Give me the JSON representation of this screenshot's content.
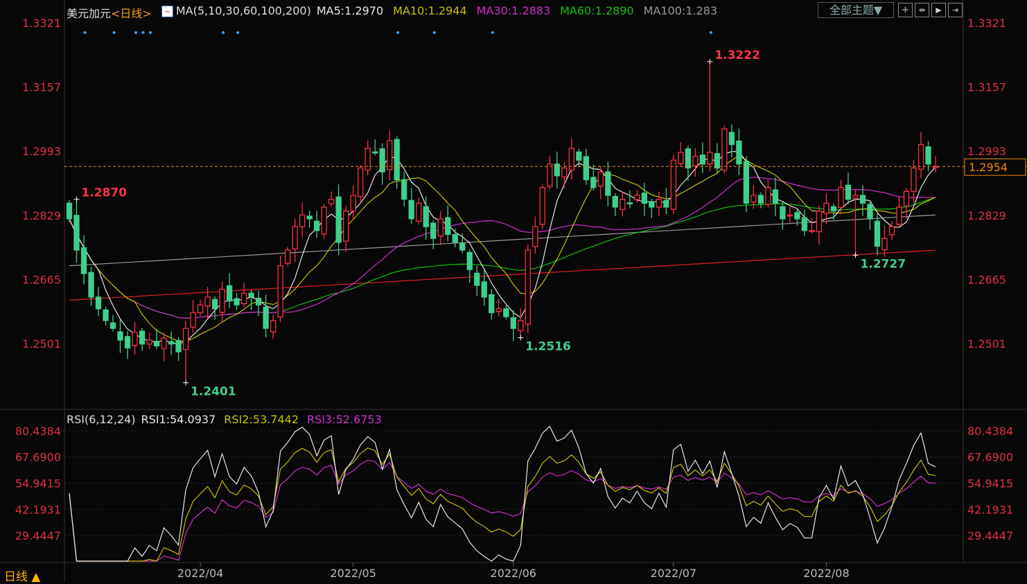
{
  "header": {
    "symbol": "美元加元",
    "period_tag": "<日线>",
    "ma_label": "MA(5,10,30,60,100,200)",
    "ma5": "MA5:1.2970",
    "ma10": "MA10:1.2944",
    "ma30": "MA30:1.2883",
    "ma60": "MA60:1.2890",
    "ma100": "MA100:1.283",
    "theme_button": "全部主题▼"
  },
  "rsi_header": {
    "label": "RSI(6,12,24)",
    "rsi1": "RSI1:54.0937",
    "rsi2": "RSI2:53.7442",
    "rsi3": "RSI3:52.6753"
  },
  "footer": {
    "period_button": "日线 ▲"
  },
  "colors": {
    "up": "#ff2d43",
    "down": "#3fcf8c",
    "ma5": "#e8e8e8",
    "ma10": "#c8c000",
    "ma30": "#d030d0",
    "ma60": "#10c010",
    "ma100": "#9a9a9a",
    "ma200": "#e02020",
    "last_price": "#f08c00"
  },
  "chart_data": [
    {
      "type": "candlestick",
      "title": "美元加元 日线",
      "y_ticks": [
        "1.3321",
        "1.3157",
        "1.2993",
        "1.2829",
        "1.2665",
        "1.2501"
      ],
      "ylim": [
        1.2401,
        1.3321
      ],
      "x_ticks": [
        {
          "label": "2022/04",
          "index": 18
        },
        {
          "label": "2022/05",
          "index": 39
        },
        {
          "label": "2022/06",
          "index": 61
        },
        {
          "label": "2022/07",
          "index": 83
        },
        {
          "label": "2022/08",
          "index": 104
        }
      ],
      "close": [
        1.282,
        1.274,
        1.268,
        1.262,
        1.259,
        1.256,
        1.254,
        1.251,
        1.249,
        1.253,
        1.25,
        1.251,
        1.2495,
        1.2515,
        1.25,
        1.248,
        1.254,
        1.258,
        1.26,
        1.262,
        1.259,
        1.264,
        1.261,
        1.26,
        1.263,
        1.262,
        1.26,
        1.254,
        1.256,
        1.27,
        1.274,
        1.28,
        1.283,
        1.282,
        1.279,
        1.285,
        1.287,
        1.276,
        1.284,
        1.288,
        1.295,
        1.3,
        1.299,
        1.294,
        1.302,
        1.292,
        1.287,
        1.282,
        1.286,
        1.28,
        1.277,
        1.282,
        1.278,
        1.276,
        1.274,
        1.269,
        1.265,
        1.262,
        1.258,
        1.259,
        1.257,
        1.254,
        1.256,
        1.274,
        1.28,
        1.29,
        1.296,
        1.293,
        1.295,
        1.3,
        1.297,
        1.292,
        1.29,
        1.294,
        1.288,
        1.285,
        1.287,
        1.286,
        1.288,
        1.286,
        1.285,
        1.287,
        1.285,
        1.297,
        1.299,
        1.295,
        1.298,
        1.296,
        1.299,
        1.295,
        1.305,
        1.301,
        1.296,
        1.286,
        1.288,
        1.286,
        1.29,
        1.286,
        1.282,
        1.283,
        1.282,
        1.279,
        1.279,
        1.284,
        1.286,
        1.284,
        1.29,
        1.287,
        1.288,
        1.286,
        1.282,
        1.275,
        1.277,
        1.28,
        1.285,
        1.289,
        1.295,
        1.301,
        1.296,
        1.2954
      ],
      "ma200_range": [
        1.2612,
        1.274
      ],
      "ma100_range": [
        1.27,
        1.283
      ],
      "annotations": [
        {
          "label": "1.2870",
          "index": 1,
          "kind": "high"
        },
        {
          "label": "1.2401",
          "index": 16,
          "kind": "low"
        },
        {
          "label": "1.2516",
          "index": 62,
          "kind": "low"
        },
        {
          "label": "1.3222",
          "index": 88,
          "kind": "high"
        },
        {
          "label": "1.2727",
          "index": 108,
          "kind": "low"
        }
      ],
      "last_price": "1.2954",
      "signal_dots": [
        1,
        5,
        8,
        9,
        10,
        20,
        22,
        44,
        49,
        57,
        87
      ]
    },
    {
      "type": "line",
      "title": "RSI(6,12,24)",
      "y_ticks": [
        "80.4384",
        "67.6900",
        "54.9415",
        "42.1931",
        "29.4447"
      ],
      "ylim": [
        29.4447,
        80.4384
      ],
      "series": [
        {
          "name": "RSI1",
          "period": 6
        },
        {
          "name": "RSI2",
          "period": 12
        },
        {
          "name": "RSI3",
          "period": 24
        }
      ]
    }
  ]
}
